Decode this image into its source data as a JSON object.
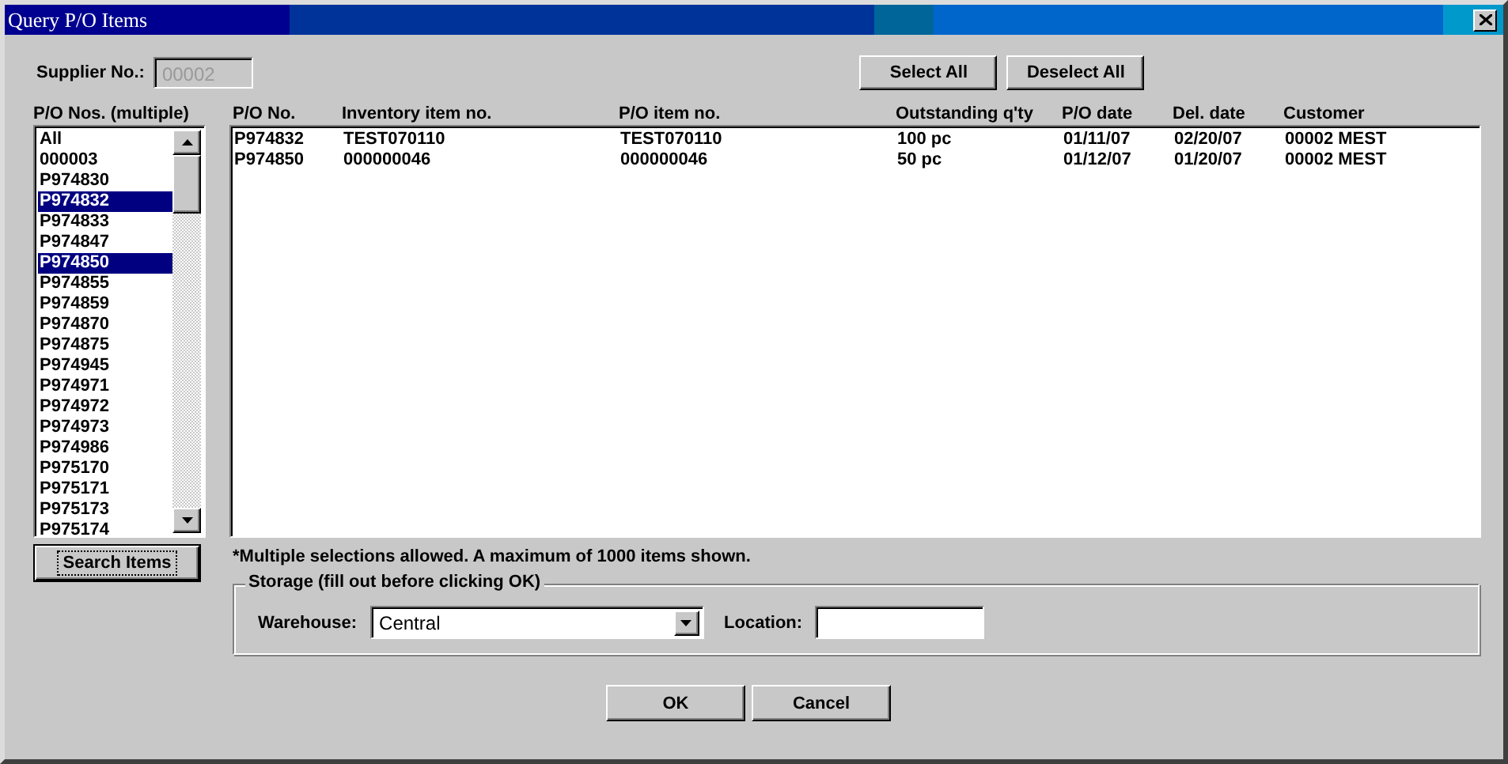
{
  "window": {
    "title": "Query P/O Items"
  },
  "supplier": {
    "label": "Supplier No.:",
    "value": "00002",
    "disabled": true
  },
  "top_buttons": [
    {
      "label": "Select All",
      "focused": false
    },
    {
      "label": "Deselect All",
      "focused": false
    }
  ],
  "po_list": {
    "label": "P/O Nos. (multiple)",
    "items": [
      {
        "text": "All",
        "selected": false
      },
      {
        "text": "000003",
        "selected": false
      },
      {
        "text": "P974830",
        "selected": false
      },
      {
        "text": "P974832",
        "selected": true
      },
      {
        "text": "P974833",
        "selected": false
      },
      {
        "text": "P974847",
        "selected": false
      },
      {
        "text": "P974850",
        "selected": true
      },
      {
        "text": "P974855",
        "selected": false
      },
      {
        "text": "P974859",
        "selected": false
      },
      {
        "text": "P974870",
        "selected": false
      },
      {
        "text": "P974875",
        "selected": false
      },
      {
        "text": "P974945",
        "selected": false
      },
      {
        "text": "P974971",
        "selected": false
      },
      {
        "text": "P974972",
        "selected": false
      },
      {
        "text": "P974973",
        "selected": false
      },
      {
        "text": "P974986",
        "selected": false
      },
      {
        "text": "P975170",
        "selected": false
      },
      {
        "text": "P975171",
        "selected": false
      },
      {
        "text": "P975173",
        "selected": false
      },
      {
        "text": "P975174",
        "selected": false
      }
    ]
  },
  "search_button": {
    "label": "Search Items",
    "focused": true
  },
  "table": {
    "columns": [
      "P/O No.",
      "Inventory item no.",
      "P/O item no.",
      "Outstanding q'ty",
      "P/O date",
      "Del. date",
      "Customer"
    ],
    "rows": [
      [
        "P974832",
        "TEST070110",
        "TEST070110",
        "100 pc",
        "01/11/07",
        "02/20/07",
        "00002 MEST"
      ],
      [
        "P974850",
        "000000046",
        "000000046",
        "50 pc",
        "01/12/07",
        "01/20/07",
        "00002 MEST"
      ]
    ]
  },
  "note": "*Multiple selections allowed. A maximum of 1000 items shown.",
  "storage": {
    "title": "Storage (fill out before clicking OK)",
    "warehouse": {
      "label": "Warehouse:",
      "value": "Central"
    },
    "location": {
      "label": "Location:"
    }
  },
  "dialog_buttons": [
    {
      "label": "OK",
      "focused": false
    },
    {
      "label": "Cancel",
      "focused": false
    }
  ]
}
